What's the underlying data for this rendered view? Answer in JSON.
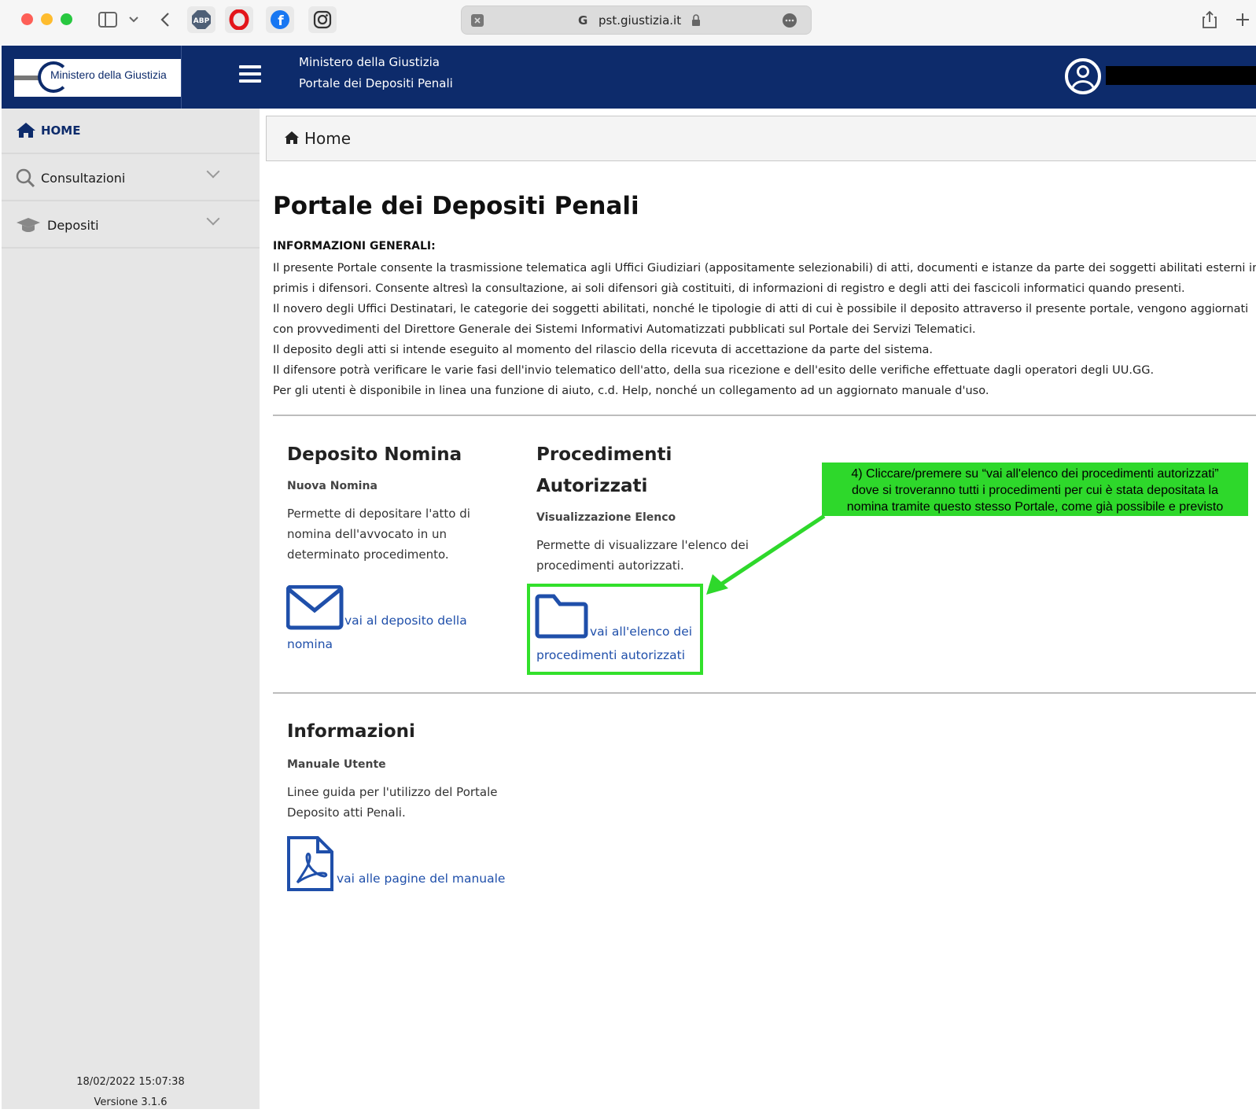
{
  "browser": {
    "url": "pst.giustizia.it",
    "extensions": [
      "adblock-icon",
      "opera-icon",
      "facebook-icon",
      "instagram-icon"
    ]
  },
  "header": {
    "logo_text": "Ministero della Giustizia",
    "title_line1": "Ministero della Giustizia",
    "title_line2": "Portale dei Depositi Penali"
  },
  "breadcrumb": {
    "label": "Home"
  },
  "sidebar": {
    "items": [
      {
        "label": "HOME",
        "icon": "home-icon"
      },
      {
        "label": "Consultazioni",
        "icon": "search-icon"
      },
      {
        "label": "Depositi",
        "icon": "graduation-cap-icon"
      }
    ],
    "footer_date": "18/02/2022 15:07:38",
    "footer_version": "Versione 3.1.6"
  },
  "main": {
    "title": "Portale dei Depositi Penali",
    "info_heading": "INFORMAZIONI GENERALI:",
    "info_lines": [
      "Il presente Portale consente la trasmissione telematica agli Uffici Giudiziari (appositamente selezionabili) di atti, documenti e istanze da parte dei soggetti abilitati esterni in",
      "primis i difensori. Consente altresì la consultazione, ai soli difensori già costituiti, di informazioni di registro e degli atti dei fascicoli informatici quando presenti.",
      "Il novero degli Uffici Destinatari, le categorie dei soggetti abilitati, nonché le tipologie di atti di cui è possibile il deposito attraverso il presente portale, vengono aggiornati",
      "con provvedimenti del Direttore Generale dei Sistemi Informativi Automatizzati pubblicati sul Portale dei Servizi Telematici.",
      "Il deposito degli atti si intende eseguito al momento del rilascio della ricevuta di accettazione da parte del sistema.",
      "Il difensore potrà verificare le varie fasi dell'invio telematico dell'atto, della sua ricezione e dell'esito delle verifiche effettuate dagli operatori degli UU.GG.",
      "Per gli utenti è disponibile in linea una funzione di aiuto, c.d. Help, nonché un collegamento ad un aggiornato manuale d'uso."
    ],
    "cards": {
      "nomina": {
        "title": "Deposito Nomina",
        "subtitle": "Nuova Nomina",
        "desc1": "Permette di depositare l'atto di",
        "desc2": "nomina dell'avvocato in un",
        "desc3": "determinato procedimento.",
        "link1": "vai al deposito della",
        "link2": "nomina",
        "icon": "envelope-icon"
      },
      "procedimenti": {
        "title1": "Procedimenti",
        "title2": "Autorizzati",
        "subtitle": "Visualizzazione Elenco",
        "desc1": "Permette di visualizzare l'elenco dei",
        "desc2": "procedimenti autorizzati.",
        "link1": "vai all'elenco dei",
        "link2": "procedimenti autorizzati",
        "icon": "folder-icon"
      },
      "informazioni": {
        "title": "Informazioni",
        "subtitle": "Manuale Utente",
        "desc1": "Linee guida per l'utilizzo del Portale",
        "desc2": "Deposito atti Penali.",
        "link": "vai alle pagine del manuale",
        "icon": "pdf-icon"
      }
    }
  },
  "annotation": {
    "line1": "4) Cliccare/premere su “vai all'elenco dei procedimenti autorizzati”",
    "line2": "dove si troveranno tutti i procedimenti per cui è stata depositata la",
    "line3": "nomina tramite questo stesso Portale, come già possibile e previsto",
    "color": "#2ed82b"
  },
  "colors": {
    "header_bg": "#0d2b6b",
    "sidebar_bg": "#e6e6e6",
    "link": "#1f4faa"
  }
}
